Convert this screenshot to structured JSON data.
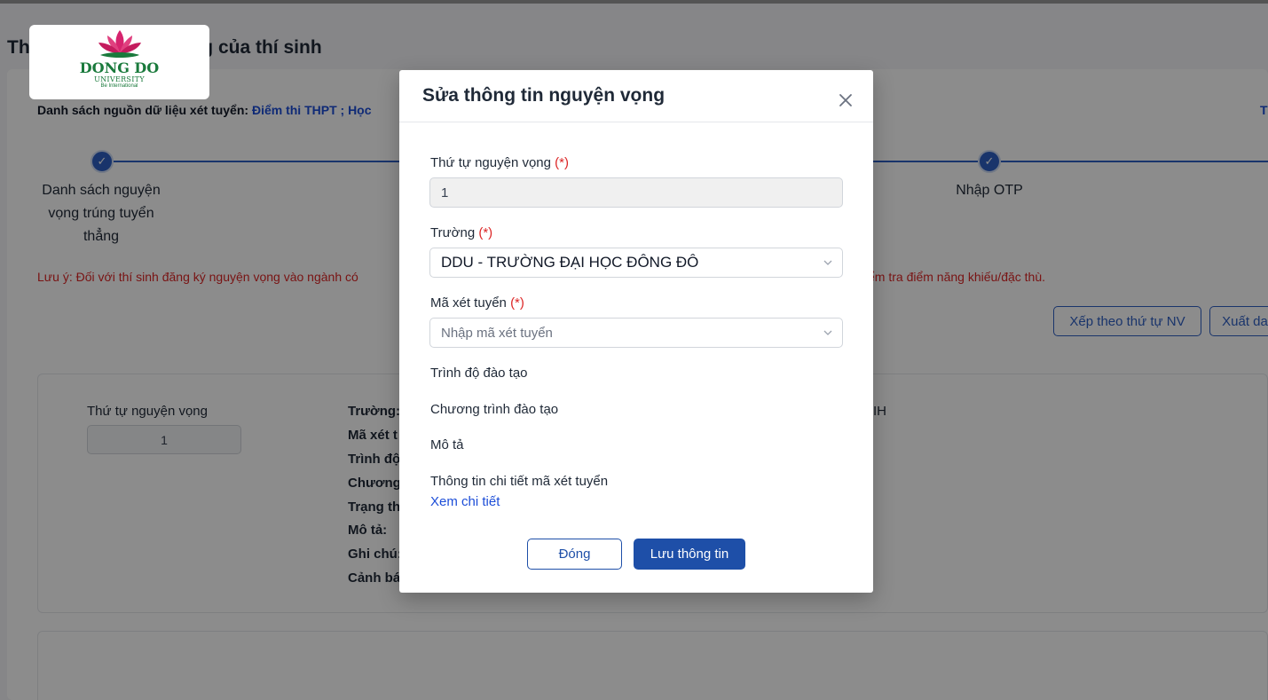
{
  "background": {
    "page_title": "Thông tin nguyện vọng của thí sinh",
    "source_label": "Danh sách nguồn dữ liệu xét tuyển:",
    "source_links": "Điểm thi THPT ; Học",
    "source_right": "T",
    "steps": [
      {
        "label_lines": [
          "Danh sách nguyện",
          "vọng trúng tuyển",
          "thẳng"
        ]
      },
      {
        "label_lines": [
          "Nhập OTP"
        ]
      }
    ],
    "note_left": "Lưu ý: Đối với thí sinh đăng ký nguyện vọng vào ngành có",
    "note_right": "ểm tra điểm năng khiếu/đặc thù.",
    "buttons": {
      "sort": "Xếp theo thứ tự NV",
      "export": "Xuất da"
    },
    "card": {
      "order_label": "Thứ tự nguyện vọng",
      "order_value": "1",
      "fields": [
        "Trường:",
        "Mã xét t",
        "Trình độ",
        "Chương",
        "Trạng th",
        "Mô tả:",
        "Ghi chú:",
        "Cảnh bá"
      ],
      "truncated_right": "IH"
    }
  },
  "logo": {
    "name": "DONG DO",
    "sub": "UNIVERSITY",
    "tagline": "Be International"
  },
  "modal": {
    "title": "Sửa thông tin nguyện vọng",
    "required_mark": "(*)",
    "order": {
      "label": "Thứ tự nguyện vọng",
      "value": "1"
    },
    "school": {
      "label": "Trường",
      "value": "DDU - TRƯỜNG ĐẠI HỌC ĐÔNG ĐÔ"
    },
    "code": {
      "label": "Mã xét tuyển",
      "placeholder": "Nhập mã xét tuyển"
    },
    "level_label": "Trình độ đào tạo",
    "program_label": "Chương trình đào tạo",
    "desc_label": "Mô tả",
    "detail_label": "Thông tin chi tiết mã xét tuyển",
    "detail_link": "Xem chi tiết",
    "buttons": {
      "close": "Đóng",
      "save": "Lưu thông tin"
    }
  },
  "colors": {
    "primary": "#1e4fa8",
    "required": "#dc2626",
    "link": "#1d4ed8",
    "logo_green": "#1a7a3c",
    "logo_pink": "#d6246e"
  }
}
